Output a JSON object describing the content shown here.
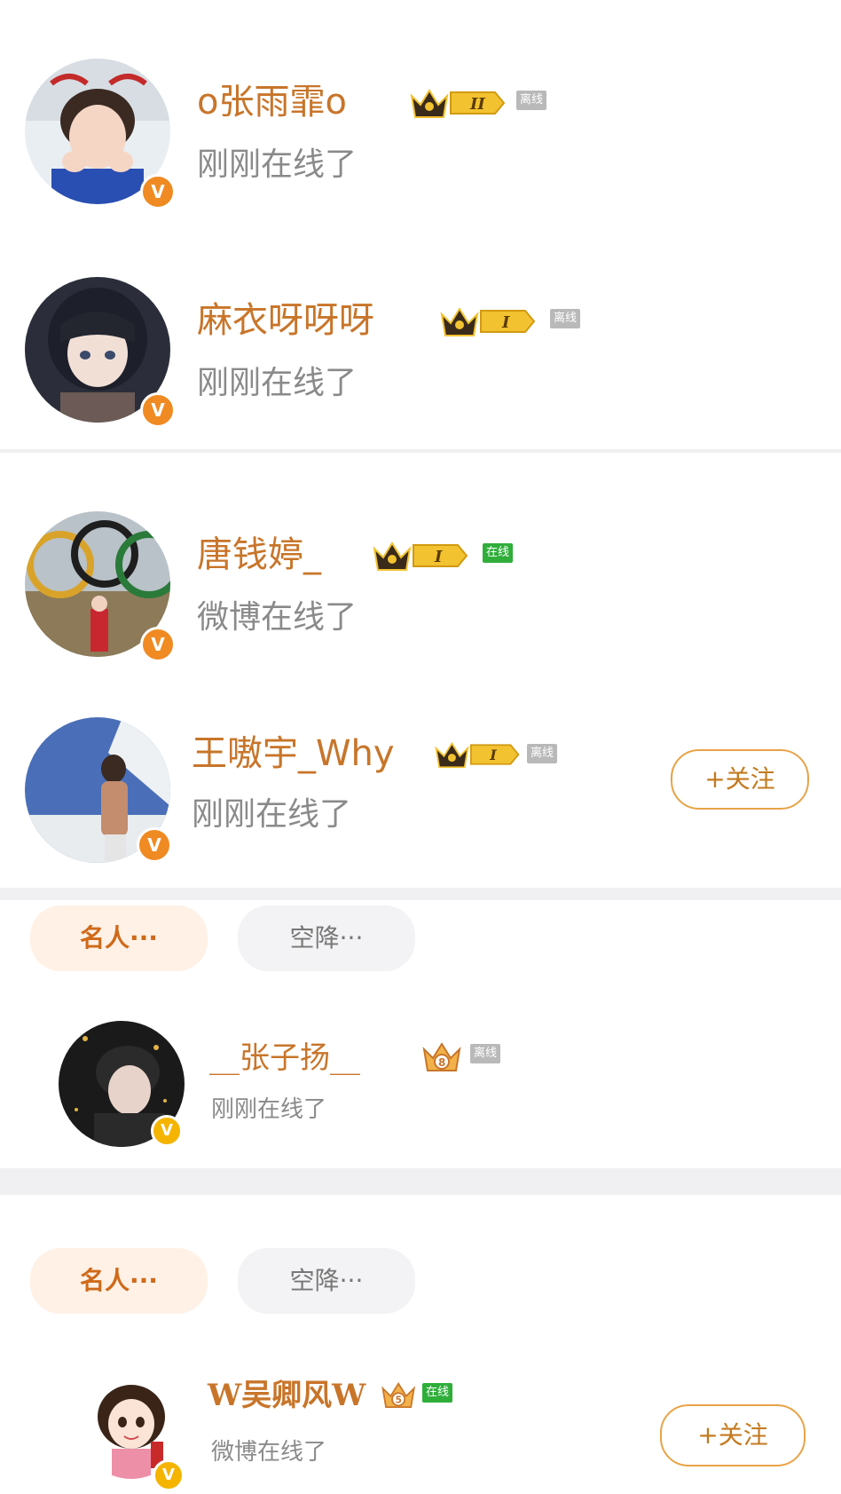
{
  "users": [
    {
      "name": "o张雨霏o",
      "level": "II",
      "presence": "离线",
      "status": "刚刚在线了"
    },
    {
      "name": "麻衣呀呀呀",
      "level": "I",
      "presence": "离线",
      "status": "刚刚在线了"
    },
    {
      "name": "唐钱婷_",
      "level": "I",
      "presence": "在线",
      "status": "微博在线了"
    },
    {
      "name": "王嗷宇_Why",
      "level": "I",
      "presence": "离线",
      "status": "刚刚在线了",
      "follow": "+关注"
    },
    {
      "name": "__张子扬__",
      "level": "8",
      "presence": "离线",
      "status": "刚刚在线了"
    },
    {
      "name": "W吴卿风W",
      "level": "5",
      "presence": "在线",
      "status": "微博在线了",
      "follow": "+关注"
    }
  ],
  "tag_rows": [
    {
      "hot": "名人···",
      "plain": "空降···"
    },
    {
      "hot": "名人···",
      "plain": "空降···"
    }
  ],
  "verify_mark": "V",
  "colors": {
    "name": "#c8752a",
    "status": "#8a8a8a",
    "verified_orange": "#f08a22",
    "verified_yellow": "#f5b400",
    "online": "#2fae3a",
    "offline": "#b9b9b9",
    "crown_gold": "#f2c230"
  }
}
